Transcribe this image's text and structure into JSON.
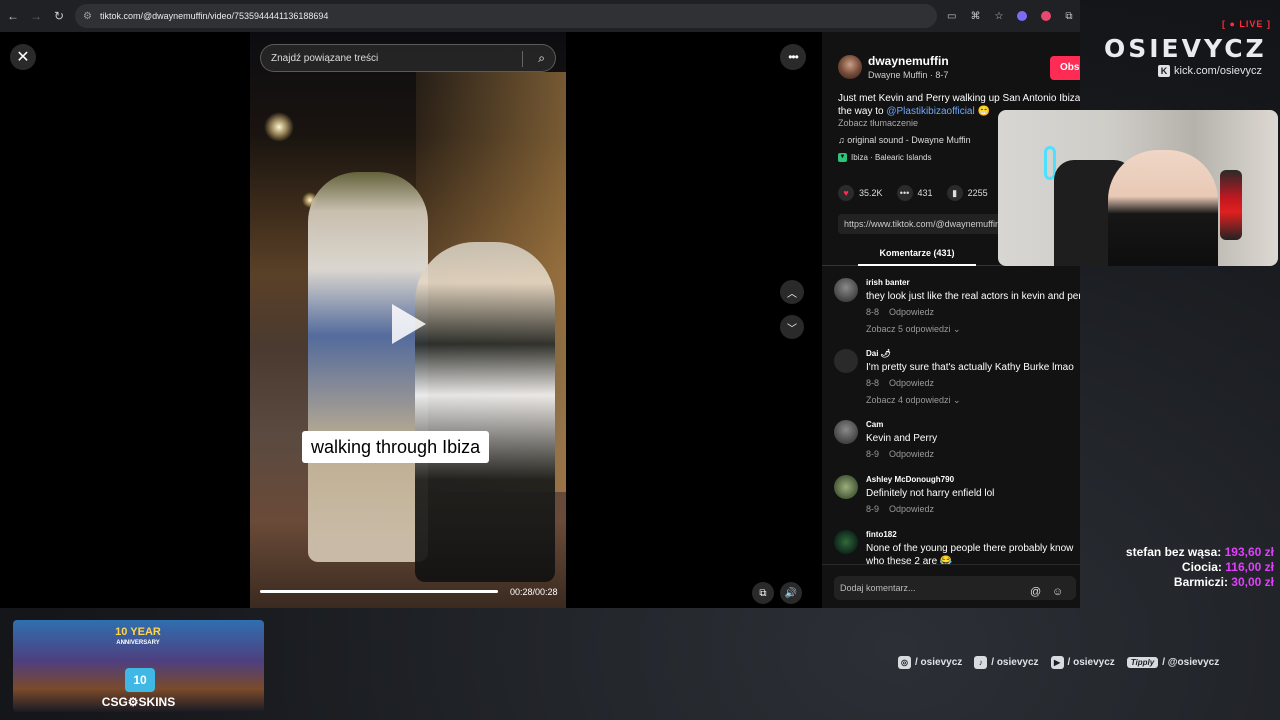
{
  "browser": {
    "url": "tiktok.com/@dwaynemuffin/video/7535944441136188694"
  },
  "tiktok": {
    "search_placeholder": "Znajdź powiązane treści",
    "caption": "walking through Ibiza",
    "time": "00:28/00:28",
    "progress_fraction": 1.0,
    "author": {
      "username": "dwaynemuffin",
      "display": "Dwayne Muffin · 8-7",
      "follow_label": "Obs"
    },
    "description_line1": "Just met Kevin and Perry walking up San Antonio Ibiza B",
    "description_line2_prefix": "the way to ",
    "description_link": "@Plastikibizaofficial",
    "description_emoji": "😁",
    "translate": "Zobacz tłumaczenie",
    "sound": "original sound - Dwayne Muffin",
    "place": "Ibiza · Balearic Islands",
    "stats": {
      "likes": "35.2K",
      "comments": "431",
      "saves": "2255"
    },
    "share_url": "https://www.tiktok.com/@dwaynemuffin",
    "comments_tab": "Komentarze (431)",
    "comments": [
      {
        "user": "irish banter",
        "text": "they look just like the real actors in kevin and perr",
        "date": "8-8",
        "reply": "Odpowiedz",
        "replies": "Zobacz 5 odpowiedzi ⌄"
      },
      {
        "user": "Dai 🌶",
        "text": "I'm pretty sure that's actually Kathy Burke lmao",
        "date": "8-8",
        "reply": "Odpowiedz",
        "replies": "Zobacz 4 odpowiedzi ⌄"
      },
      {
        "user": "Cam",
        "text": "Kevin and Perry",
        "date": "8-9",
        "reply": "Odpowiedz"
      },
      {
        "user": "Ashley McDonough790",
        "text": "Definitely not harry enfield lol",
        "date": "8-9",
        "reply": "Odpowiedz"
      },
      {
        "user": "finto182",
        "text": "None of the young people there probably know",
        "text2": "who these 2 are 😂"
      }
    ],
    "add_comment": "Dodaj komentarz..."
  },
  "overlay": {
    "live": "[ ● LIVE ]",
    "brand": "OSIEVYCZ",
    "kick": "kick.com/osievycz",
    "donations": [
      {
        "name": "stefan bez wąsa:",
        "amount": "193,60 zł"
      },
      {
        "name": "Ciocia:",
        "amount": "116,00 zł"
      },
      {
        "name": "Barmiczi:",
        "amount": "30,00 zł"
      }
    ],
    "banner_title": "10 YEAR",
    "banner_sub": "ANNIVERSARY",
    "banner_cake": "10",
    "banner_brand": "CSG⚙SKINS",
    "socials": [
      {
        "icon": "instagram-icon",
        "glyph": "◎",
        "handle": "/ osievycz"
      },
      {
        "icon": "tiktok-icon",
        "glyph": "♪",
        "handle": "/ osievycz"
      },
      {
        "icon": "youtube-icon",
        "glyph": "▶",
        "handle": "/ osievycz"
      },
      {
        "icon": "tipply-icon",
        "glyph": "Tipply",
        "handle": "/ @osievycz"
      }
    ]
  }
}
